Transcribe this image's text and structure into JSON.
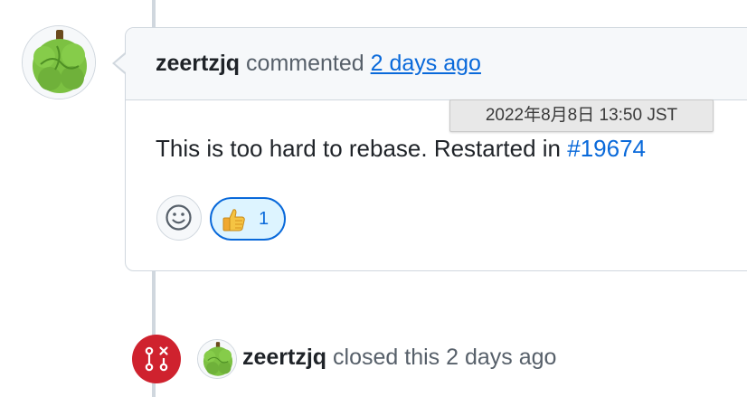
{
  "comment": {
    "author": "zeertzjq",
    "action": "commented",
    "time_ago": "2 days ago",
    "tooltip": "2022年8月8日 13:50 JST",
    "body_prefix": "This is too hard to rebase. Restarted in ",
    "body_link": "#19674",
    "reactions": [
      {
        "emoji": "thumbs-up",
        "count": "1"
      }
    ]
  },
  "event": {
    "author": "zeertzjq",
    "text": "closed this 2 days ago"
  },
  "colors": {
    "link": "#0969da",
    "closed_red": "#cf222e",
    "border": "#d0d7de",
    "avatar_green": "#7cc142"
  },
  "icons": {
    "emoji_picker": "smiley-icon",
    "reaction": "thumbs-up-icon",
    "closed": "git-pull-request-closed-icon"
  }
}
